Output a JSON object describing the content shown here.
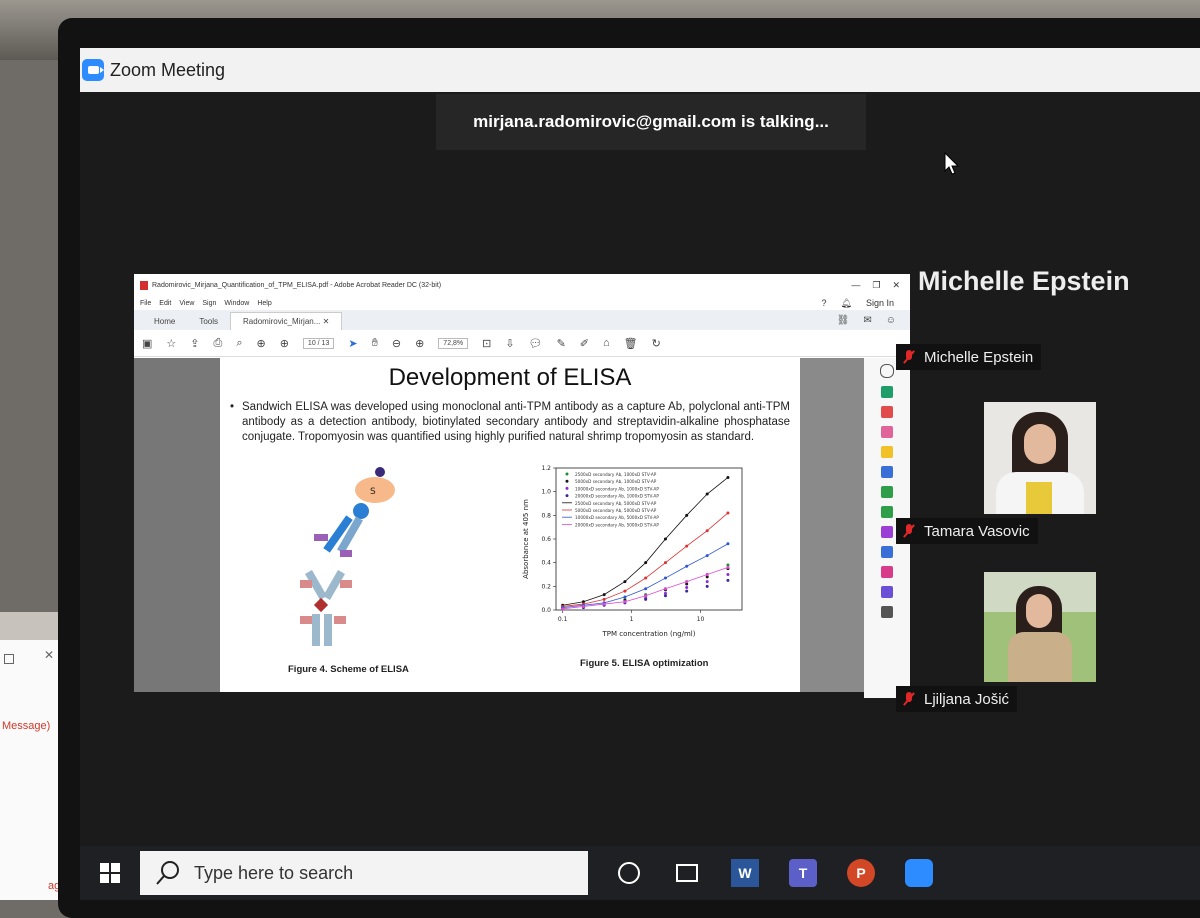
{
  "zoom": {
    "title": "Zoom Meeting",
    "talking": "mirjana.radomirovic@gmail.com is talking...",
    "gallery_name": "Michelle Epstein",
    "participants": [
      {
        "name": "Michelle Epstein",
        "muted": true
      },
      {
        "name": "Tamara Vasovic",
        "muted": true
      },
      {
        "name": "Ljiljana Jošić",
        "muted": true
      }
    ]
  },
  "acrobat": {
    "window_title": "Radomirovic_Mirjana_Quantification_of_TPM_ELISA.pdf - Adobe Acrobat Reader DC (32-bit)",
    "menu": [
      "File",
      "Edit",
      "View",
      "Sign",
      "Window",
      "Help"
    ],
    "sign_in": "Sign In",
    "tabs": {
      "home": "Home",
      "tools": "Tools",
      "doc": "Radomirovic_Mirjan..."
    },
    "page_current": "10",
    "page_total": "/ 13",
    "zoom": "72,8%"
  },
  "slide": {
    "title": "Development of ELISA",
    "body": "Sandwich ELISA was developed using monoclonal anti-TPM antibody as a capture Ab, polyclonal anti-TPM antibody as a detection antibody, biotinylated secondary antibody and streptavidin-alkaline phosphatase conjugate. Tropomyosin was quantified using highly purified natural shrimp tropomyosin as standard.",
    "scheme_label": "S",
    "fig4": "Figure 4. Scheme of ELISA",
    "fig5": "Figure 5. ELISA optimization"
  },
  "chart_data": {
    "type": "line",
    "xlabel": "TPM concentration (ng/ml)",
    "ylabel": "Absorbance at 405 nm",
    "xscale": "log",
    "xlim": [
      0.08,
      40
    ],
    "ylim": [
      0,
      1.2
    ],
    "x_ticks": [
      "0.1",
      "1",
      "10"
    ],
    "y_ticks": [
      "0.0",
      "0.2",
      "0.4",
      "0.6",
      "0.8",
      "1.0",
      "1.2"
    ],
    "x": [
      0.1,
      0.2,
      0.4,
      0.8,
      1.6,
      3.1,
      6.3,
      12.5,
      25
    ],
    "series": [
      {
        "name": "2500xD secondary Ab, 1000xD STV-AP",
        "color": "#1e8f2e",
        "values": [
          0.03,
          0.04,
          0.06,
          0.09,
          0.13,
          0.18,
          0.24,
          0.3,
          0.38
        ]
      },
      {
        "name": "5000xD secondary Ab, 1000xD STV-AP",
        "color": "#1a1a1a",
        "values": [
          0.02,
          0.03,
          0.05,
          0.08,
          0.12,
          0.17,
          0.22,
          0.28,
          0.35
        ]
      },
      {
        "name": "10000xD secondary Ab, 1000xD STV-AP",
        "color": "#8e2bd6",
        "values": [
          0.02,
          0.03,
          0.05,
          0.07,
          0.1,
          0.14,
          0.19,
          0.24,
          0.3
        ]
      },
      {
        "name": "20000xD secondary Ab, 1000xD STV-AP",
        "color": "#3a2a9c",
        "values": [
          0.01,
          0.02,
          0.04,
          0.06,
          0.09,
          0.12,
          0.16,
          0.2,
          0.25
        ]
      },
      {
        "name": "2500xD secondary Ab, 5000xD STV-AP",
        "color": "#111111",
        "values": [
          0.04,
          0.07,
          0.13,
          0.24,
          0.4,
          0.6,
          0.8,
          0.98,
          1.12
        ]
      },
      {
        "name": "5000xD secondary Ab, 5000xD STV-AP",
        "color": "#e03030",
        "values": [
          0.03,
          0.05,
          0.09,
          0.16,
          0.27,
          0.4,
          0.54,
          0.67,
          0.82
        ]
      },
      {
        "name": "10000xD secondary Ab, 5000xD STV-AP",
        "color": "#2f55d4",
        "values": [
          0.02,
          0.04,
          0.06,
          0.11,
          0.18,
          0.27,
          0.37,
          0.46,
          0.56
        ]
      },
      {
        "name": "20000xD secondary Ab, 5000xD STV-AP",
        "color": "#e04bd6",
        "values": [
          0.01,
          0.03,
          0.05,
          0.07,
          0.12,
          0.18,
          0.24,
          0.3,
          0.36
        ]
      }
    ]
  },
  "taskbar": {
    "search_placeholder": "Type here to search"
  },
  "phone": {
    "message_label": "Message)",
    "bottom_label": "age)"
  }
}
